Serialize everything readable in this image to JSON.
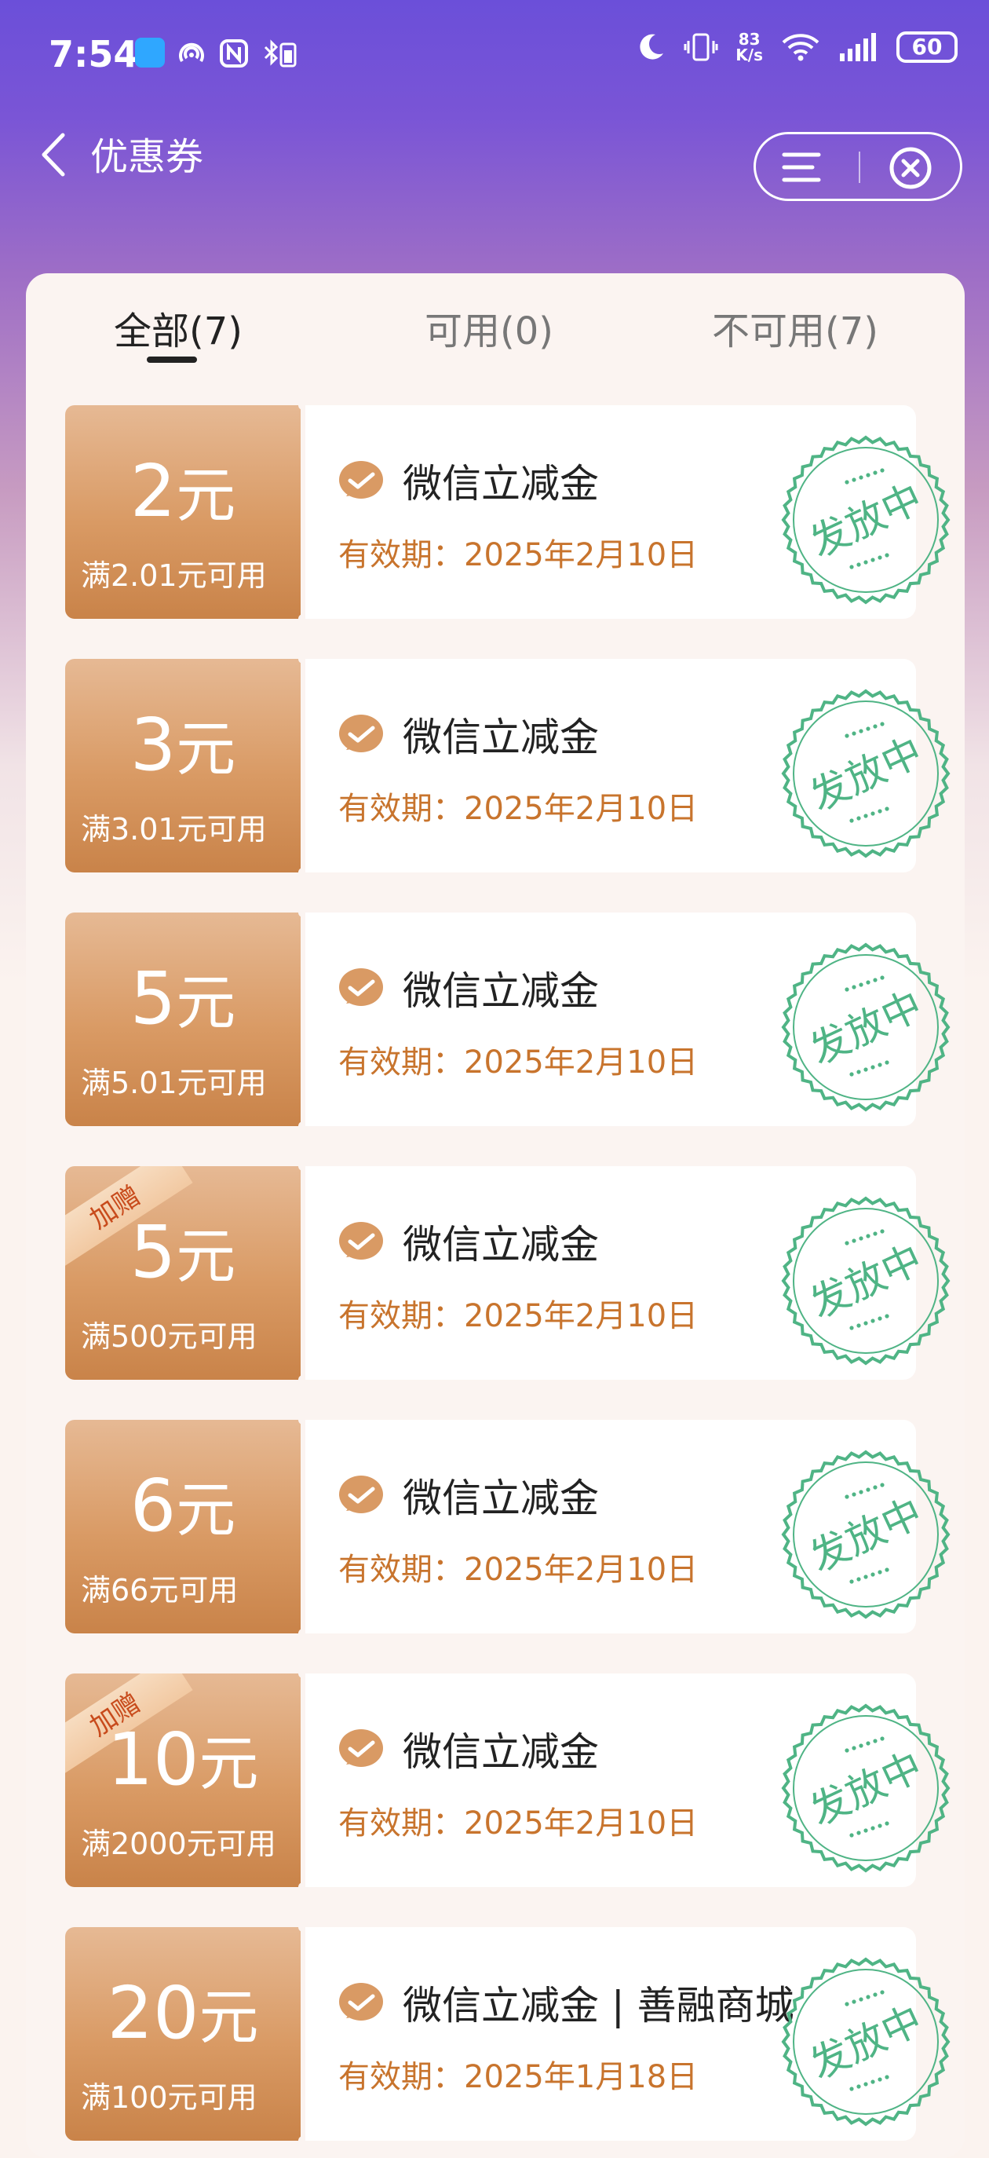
{
  "status_bar": {
    "time": "7:54",
    "net_speed_value": "83",
    "net_speed_unit": "K/s",
    "battery": "60",
    "icons": [
      "message-icon",
      "nfc-scan-icon",
      "nfc-icon",
      "bluetooth-battery-icon",
      "moon-icon",
      "vibrate-icon",
      "wifi-icon",
      "signal-icon",
      "battery-icon"
    ]
  },
  "header": {
    "title": "优惠券",
    "back_icon": "back-chevron-icon",
    "menu_icon": "menu-icon",
    "close_icon": "close-icon"
  },
  "tabs": [
    {
      "label": "全部(7)",
      "active": true
    },
    {
      "label": "可用(0)",
      "active": false
    },
    {
      "label": "不可用(7)",
      "active": false
    }
  ],
  "colors": {
    "coupon_gold": "#d99a64",
    "expiry_text": "#c8742d",
    "stamp_green": "#4fb485"
  },
  "coupons": [
    {
      "amount": "2",
      "unit": "元",
      "condition": "满2.01元可用",
      "name": "微信立减金",
      "expiry": "有效期：2025年2月10日",
      "stamp": "发放中",
      "tag": ""
    },
    {
      "amount": "3",
      "unit": "元",
      "condition": "满3.01元可用",
      "name": "微信立减金",
      "expiry": "有效期：2025年2月10日",
      "stamp": "发放中",
      "tag": ""
    },
    {
      "amount": "5",
      "unit": "元",
      "condition": "满5.01元可用",
      "name": "微信立减金",
      "expiry": "有效期：2025年2月10日",
      "stamp": "发放中",
      "tag": ""
    },
    {
      "amount": "5",
      "unit": "元",
      "condition": "满500元可用",
      "name": "微信立减金",
      "expiry": "有效期：2025年2月10日",
      "stamp": "发放中",
      "tag": "加赠"
    },
    {
      "amount": "6",
      "unit": "元",
      "condition": "满66元可用",
      "name": "微信立减金",
      "expiry": "有效期：2025年2月10日",
      "stamp": "发放中",
      "tag": ""
    },
    {
      "amount": "10",
      "unit": "元",
      "condition": "满2000元可用",
      "name": "微信立减金",
      "expiry": "有效期：2025年2月10日",
      "stamp": "发放中",
      "tag": "加赠"
    },
    {
      "amount": "20",
      "unit": "元",
      "condition": "满100元可用",
      "name": "微信立减金 | 善融商城",
      "expiry": "有效期：2025年1月18日",
      "stamp": "发放中",
      "tag": ""
    }
  ]
}
